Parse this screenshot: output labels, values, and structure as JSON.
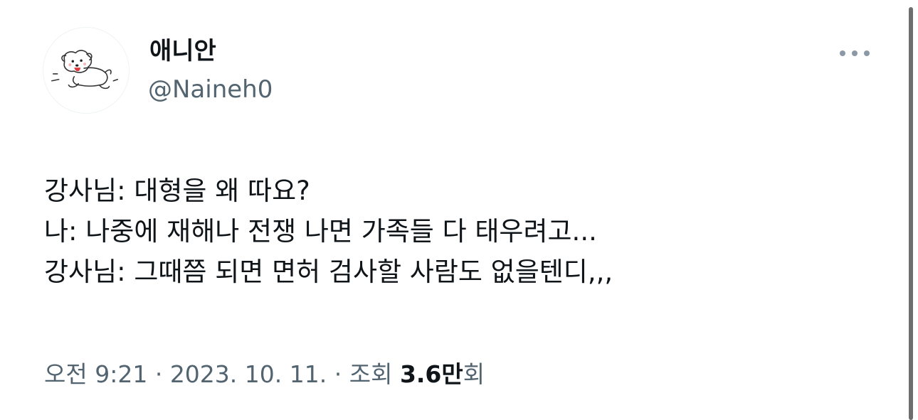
{
  "author": {
    "display_name": "애니안",
    "handle": "@Naineh0",
    "avatar_icon": "dog-avatar-icon"
  },
  "more_icon": "more-horizontal-icon",
  "tweet": {
    "lines": [
      "강사님: 대형을 왜 따요?",
      "나: 나중에 재해나 전쟁 나면 가족들 다 태우려고...",
      "강사님: 그때쯤 되면 면허 검사할 사람도 없을텐디,,,"
    ]
  },
  "meta": {
    "time": "오전 9:21",
    "separator": " · ",
    "date": "2023. 10. 11.",
    "views_label": "조회 ",
    "views_count": "3.6만",
    "views_suffix": "회"
  },
  "colors": {
    "text_primary": "#0f1419",
    "text_secondary": "#536471",
    "background": "#ffffff",
    "scrollbar": "#6e6e6e"
  }
}
